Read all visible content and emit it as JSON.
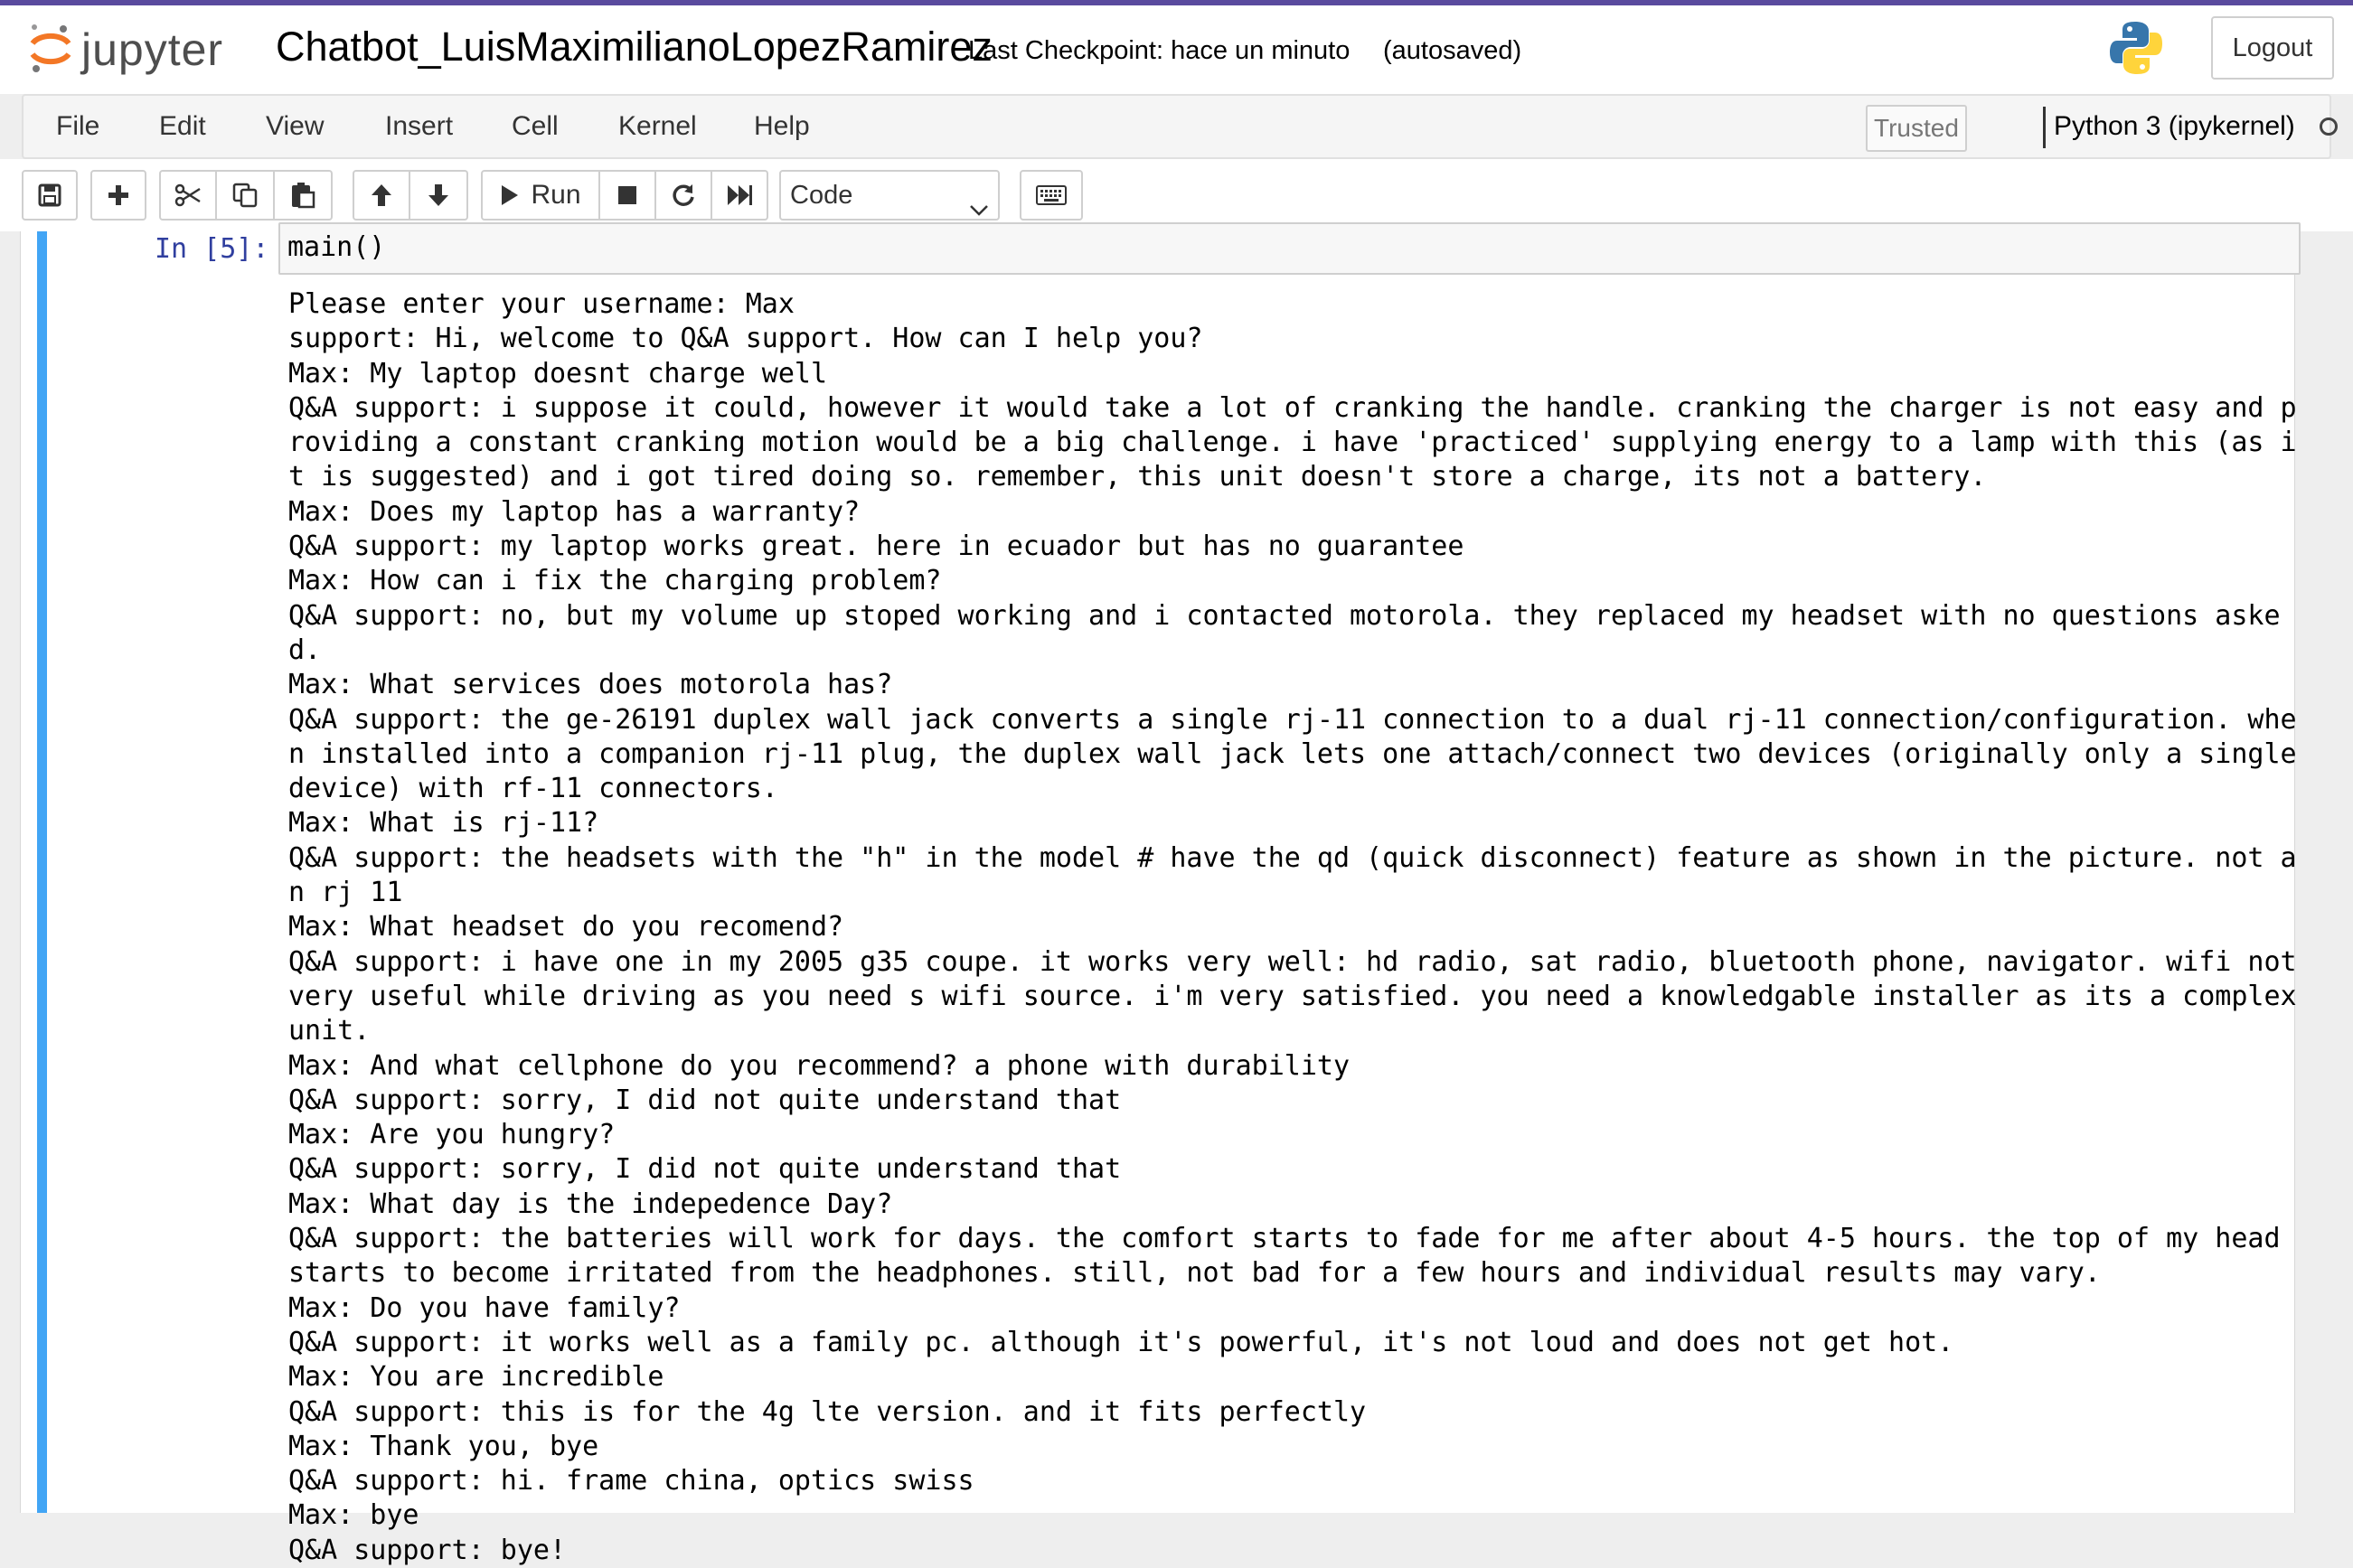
{
  "header": {
    "logo_text": "jupyter",
    "notebook_title": "Chatbot_LuisMaximilianoLopezRamirez",
    "checkpoint": "Last Checkpoint: hace un minuto",
    "autosave_status": "(autosaved)",
    "logout_label": "Logout"
  },
  "menubar": {
    "items": [
      "File",
      "Edit",
      "View",
      "Insert",
      "Cell",
      "Kernel",
      "Help"
    ],
    "trusted_label": "Trusted",
    "kernel_name": "Python 3 (ipykernel)"
  },
  "toolbar": {
    "run_label": "Run",
    "cell_type": "Code",
    "icons": [
      "save-icon",
      "plus-icon",
      "cut-icon",
      "copy-icon",
      "paste-icon",
      "arrow-up-icon",
      "arrow-down-icon",
      "play-icon",
      "stop-icon",
      "restart-icon",
      "fast-forward-icon",
      "keyboard-icon"
    ]
  },
  "cell": {
    "prompt": "In [5]:",
    "code": "main()",
    "output_lines": [
      "Please enter your username: Max",
      "support: Hi, welcome to Q&A support. How can I help you?",
      "Max: My laptop doesnt charge well",
      "Q&A support: i suppose it could, however it would take a lot of cranking the handle. cranking the charger is not easy and providing a constant cranking motion would be a big challenge. i have 'practiced' supplying energy to a lamp with this (as it is suggested) and i got tired doing so. remember, this unit doesn't store a charge, its not a battery.",
      "Max: Does my laptop has a warranty?",
      "Q&A support: my laptop works great. here in ecuador but has no guarantee",
      "Max: How can i fix the charging problem?",
      "Q&A support: no, but my volume up stoped working and i contacted motorola. they replaced my headset with no questions asked.",
      "Max: What services does motorola has?",
      "Q&A support: the ge-26191 duplex wall jack converts a single rj-11 connection to a dual rj-11 connection/configuration. when installed into a companion rj-11 plug, the duplex wall jack lets one attach/connect two devices (originally only a single device) with rf-11 connectors.",
      "Max: What is rj-11?",
      "Q&A support: the headsets with the \"h\" in the model # have the qd (quick disconnect) feature as shown in the picture. not an rj 11",
      "Max: What headset do you recomend?",
      "Q&A support: i have one in my 2005 g35 coupe. it works very well: hd radio, sat radio, bluetooth phone, navigator. wifi not very useful while driving as you need s wifi source. i'm very satisfied. you need a knowledgable installer as its a complex unit.",
      "Max: And what cellphone do you recommend? a phone with durability",
      "Q&A support: sorry, I did not quite understand that",
      "Max: Are you hungry?",
      "Q&A support: sorry, I did not quite understand that",
      "Max: What day is the indepedence Day?",
      "Q&A support: the batteries will work for days. the comfort starts to fade for me after about 4-5 hours. the top of my head starts to become irritated from the headphones. still, not bad for a few hours and individual results may vary.",
      "Max: Do you have family?",
      "Q&A support: it works well as a family pc. although it's powerful, it's not loud and does not get hot.",
      "Max: You are incredible",
      "Q&A support: this is for the 4g lte version. and it fits perfectly",
      "Max: Thank you, bye",
      "Q&A support: hi. frame china, optics swiss",
      "Max: bye",
      "Q&A support: bye!"
    ]
  }
}
